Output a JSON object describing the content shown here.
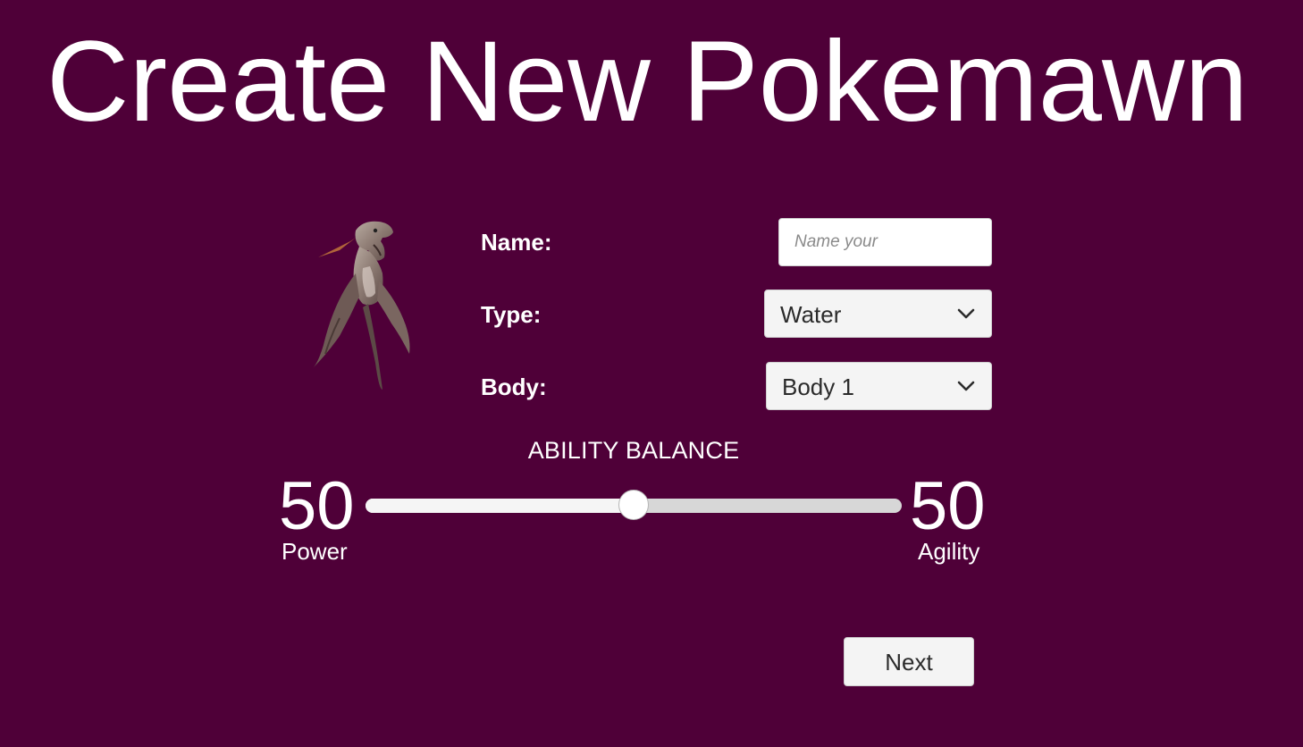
{
  "title": "Create New Pokemawn",
  "form": {
    "name_label": "Name:",
    "name_placeholder": "Name your",
    "name_value": "",
    "type_label": "Type:",
    "type_selected": "Water",
    "body_label": "Body:",
    "body_selected": "Body 1"
  },
  "ability": {
    "title": "ABILITY BALANCE",
    "power_value": "50",
    "power_label": "Power",
    "agility_value": "50",
    "agility_label": "Agility",
    "balance_fraction": 0.5
  },
  "next_label": "Next",
  "icons": {
    "dropdown": "chevron-down-icon",
    "creature": "creature-sprite"
  },
  "colors": {
    "background": "#4f0038",
    "text": "#ffffff",
    "control_bg": "#f4f4f4"
  }
}
